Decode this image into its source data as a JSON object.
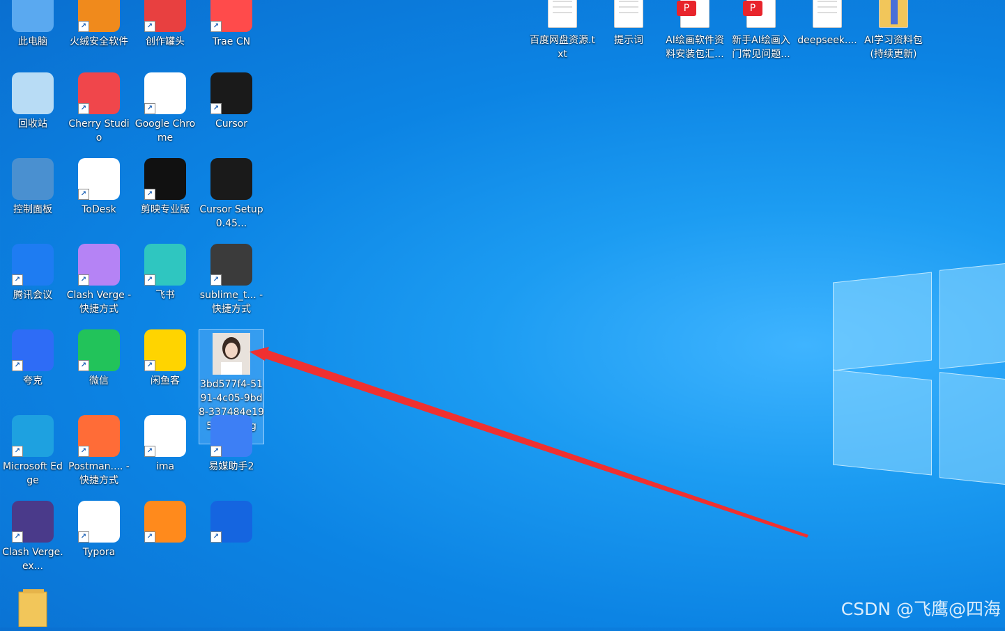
{
  "desktop": {
    "left_icons": [
      {
        "name": "this-pc",
        "label": "此电脑",
        "icon": "monitor-icon",
        "color": "#5aa9f0",
        "shortcut": false
      },
      {
        "name": "huorong",
        "label": "火绒安全软件",
        "icon": "flame-shield-icon",
        "color": "#f08a1c",
        "shortcut": true
      },
      {
        "name": "chuangzuo",
        "label": "创作罐头",
        "icon": "can-icon",
        "color": "#e84040",
        "shortcut": true
      },
      {
        "name": "trae-cn",
        "label": "Trae CN",
        "icon": "trae-icon",
        "color": "#ff4b4b",
        "shortcut": true
      },
      {
        "name": "recycle-bin",
        "label": "回收站",
        "icon": "recycle-bin-icon",
        "color": "#b8dcf5",
        "shortcut": false
      },
      {
        "name": "cherry-studio",
        "label": "Cherry Studio",
        "icon": "cherry-icon",
        "color": "#f0464b",
        "shortcut": true
      },
      {
        "name": "google-chrome",
        "label": "Google Chrome",
        "icon": "chrome-icon",
        "color": "#ffffff",
        "shortcut": true
      },
      {
        "name": "cursor",
        "label": "Cursor",
        "icon": "cursor-cube-icon",
        "color": "#1a1a1a",
        "shortcut": true
      },
      {
        "name": "control-panel",
        "label": "控制面板",
        "icon": "control-panel-icon",
        "color": "#4a90d0",
        "shortcut": false
      },
      {
        "name": "todesk",
        "label": "ToDesk",
        "icon": "todesk-icon",
        "color": "#ffffff",
        "shortcut": true
      },
      {
        "name": "jianying",
        "label": "剪映专业版",
        "icon": "capcut-icon",
        "color": "#111111",
        "shortcut": true
      },
      {
        "name": "cursor-setup",
        "label": "Cursor Setup 0.45...",
        "icon": "cursor-setup-icon",
        "color": "#1a1a1a",
        "shortcut": false
      },
      {
        "name": "tencent-meeting",
        "label": "腾讯会议",
        "icon": "tencent-meeting-icon",
        "color": "#1e7cf2",
        "shortcut": true
      },
      {
        "name": "clash-verge-shortcut",
        "label": "Clash Verge - 快捷方式",
        "icon": "cat-icon",
        "color": "#b583f5",
        "shortcut": true
      },
      {
        "name": "feishu",
        "label": "飞书",
        "icon": "feishu-bird-icon",
        "color": "#2fc6c0",
        "shortcut": true
      },
      {
        "name": "sublime",
        "label": "sublime_t... - 快捷方式",
        "icon": "sublime-icon",
        "color": "#3b3b3b",
        "shortcut": true
      },
      {
        "name": "quark",
        "label": "夸克",
        "icon": "quark-icon",
        "color": "#2e6cf6",
        "shortcut": true
      },
      {
        "name": "wechat",
        "label": "微信",
        "icon": "wechat-icon",
        "color": "#22c35a",
        "shortcut": true
      },
      {
        "name": "xianyu",
        "label": "闲鱼客",
        "icon": "xianyu-icon",
        "color": "#ffd400",
        "shortcut": true
      },
      {
        "name": "image-file",
        "label": "3bd577f4-5191-4c05-9bd8-337484e19575-1.png",
        "icon": "image-thumbnail-icon",
        "color": "#d9d0c8",
        "shortcut": false
      },
      {
        "name": "microsoft-edge",
        "label": "Microsoft Edge",
        "icon": "edge-icon",
        "color": "#1ea1e0",
        "shortcut": true
      },
      {
        "name": "postman",
        "label": "Postman.... - 快捷方式",
        "icon": "postman-icon",
        "color": "#ff6c37",
        "shortcut": true
      },
      {
        "name": "ima",
        "label": "ima",
        "icon": "panda-icon",
        "color": "#ffffff",
        "shortcut": true
      },
      {
        "name": "yimei",
        "label": "易媒助手2",
        "icon": "yimei-icon",
        "color": "#3d7ff5",
        "shortcut": true
      },
      {
        "name": "clash-verge-exe",
        "label": "Clash Verge.ex...",
        "icon": "cat-glasses-icon",
        "color": "#4a3a8a",
        "shortcut": true
      },
      {
        "name": "typora",
        "label": "Typora",
        "icon": "typora-icon",
        "color": "#ffffff",
        "shortcut": true
      },
      {
        "name": "app-orange",
        "label": "",
        "icon": "orange-app-icon",
        "color": "#ff8a1c",
        "shortcut": true
      },
      {
        "name": "app-n",
        "label": "",
        "icon": "n-logo-icon",
        "color": "#1565e0",
        "shortcut": true
      },
      {
        "name": "folder",
        "label": "",
        "icon": "folder-icon",
        "color": "#f2c65a",
        "shortcut": false
      }
    ],
    "top_files": [
      {
        "name": "baidu-txt",
        "label": "百度网盘资源.txt",
        "icon": "text-file-icon"
      },
      {
        "name": "tishici",
        "label": "提示词",
        "icon": "text-file-icon"
      },
      {
        "name": "ai-drawing-pdf",
        "label": "AI绘画软件资料安装包汇...",
        "icon": "pdf-file-icon"
      },
      {
        "name": "ai-beginner-pdf",
        "label": "新手AI绘画入门常见问题...",
        "icon": "pdf-file-icon"
      },
      {
        "name": "deepseek",
        "label": "deepseek....",
        "icon": "text-file-icon"
      },
      {
        "name": "ai-learning-folder",
        "label": "AI学习资料包(持续更新)",
        "icon": "folder-zip-icon"
      }
    ]
  },
  "watermark": "CSDN @飞鹰@四海",
  "annotation_arrow_color": "#f03030"
}
